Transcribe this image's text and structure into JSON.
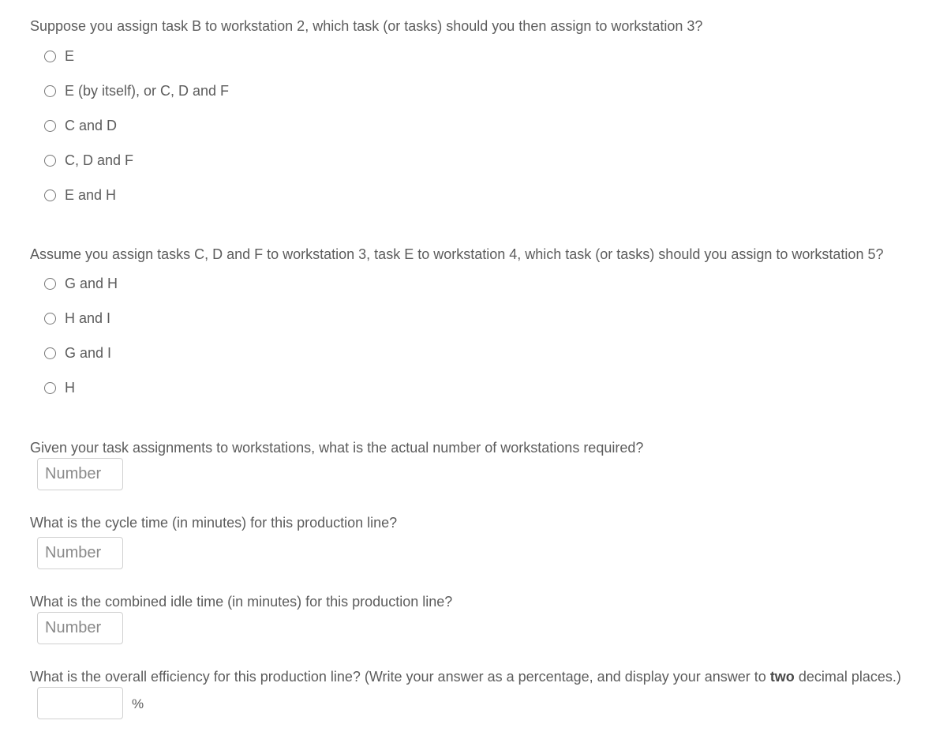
{
  "questions": [
    {
      "text": "Suppose you assign task B to workstation 2, which task (or tasks) should you then assign to workstation 3?",
      "type": "radio",
      "options": [
        "E",
        "E (by itself), or C, D and F",
        "C and D",
        "C, D and F",
        "E and H"
      ]
    },
    {
      "text": "Assume you assign tasks C, D and F to workstation 3, task E to workstation 4, which task (or tasks) should you assign to workstation 5?",
      "type": "radio",
      "options": [
        "G and H",
        "H and I",
        "G and I",
        "H"
      ]
    },
    {
      "text": "Given your task assignments to workstations, what is the actual number of workstations required?",
      "type": "number",
      "placeholder": "Number",
      "value": ""
    },
    {
      "text": "What is the cycle time (in minutes) for this production line?",
      "type": "number",
      "placeholder": "Number",
      "value": ""
    },
    {
      "text": "What is the combined idle time (in minutes) for this production line?",
      "type": "number",
      "placeholder": "Number",
      "value": ""
    },
    {
      "text_before": "What is the overall efficiency for this production line? (Write your answer as a percentage, and display your answer to ",
      "text_bold": "two",
      "text_after": " decimal places.)",
      "type": "number",
      "placeholder": "",
      "value": "",
      "unit": "%"
    }
  ]
}
